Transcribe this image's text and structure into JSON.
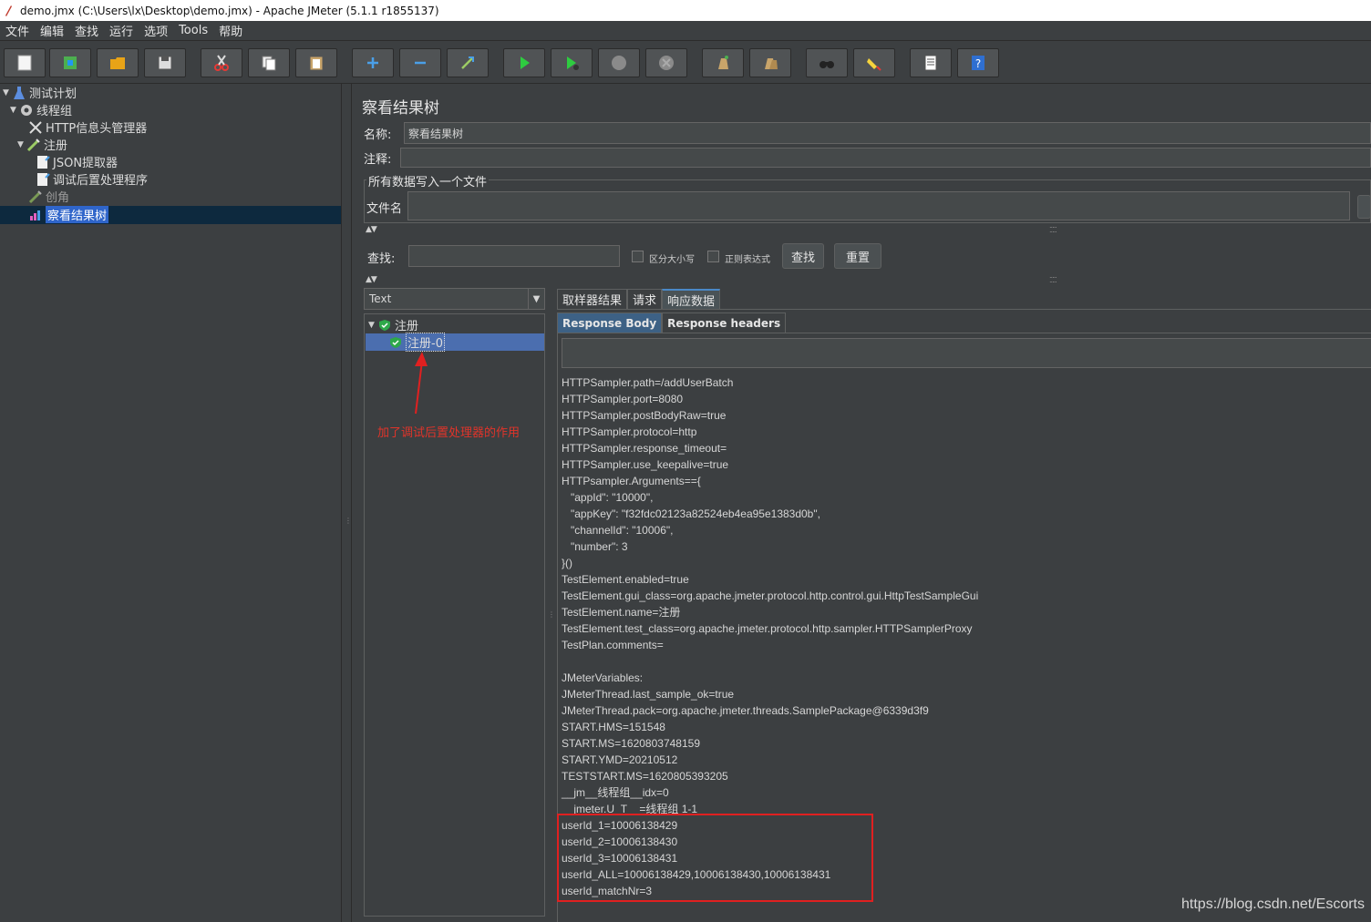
{
  "window": {
    "title": "demo.jmx (C:\\Users\\lx\\Desktop\\demo.jmx) - Apache JMeter (5.1.1 r1855137)"
  },
  "menubar": {
    "items": [
      {
        "label": "文件"
      },
      {
        "label": "编辑"
      },
      {
        "label": "查找"
      },
      {
        "label": "运行"
      },
      {
        "label": "选项"
      },
      {
        "label": "Tools"
      },
      {
        "label": "帮助"
      }
    ]
  },
  "toolbar": {
    "buttons": [
      {
        "icon": "new-icon"
      },
      {
        "icon": "templates-icon"
      },
      {
        "icon": "open-icon"
      },
      {
        "icon": "save-icon"
      },
      {
        "icon": "cut-icon"
      },
      {
        "icon": "copy-icon"
      },
      {
        "icon": "paste-icon"
      },
      {
        "icon": "expand-icon"
      },
      {
        "icon": "collapse-icon"
      },
      {
        "icon": "toggle-icon"
      },
      {
        "icon": "start-icon"
      },
      {
        "icon": "start-no-pause-icon"
      },
      {
        "icon": "stop-icon"
      },
      {
        "icon": "shutdown-icon"
      },
      {
        "icon": "clear-icon"
      },
      {
        "icon": "clear-all-icon"
      },
      {
        "icon": "search-icon"
      },
      {
        "icon": "reset-search-icon"
      },
      {
        "icon": "function-helper-icon"
      },
      {
        "icon": "help-icon"
      }
    ]
  },
  "tree": {
    "items": [
      {
        "label": "测试计划",
        "icon": "test-plan-icon"
      },
      {
        "label": "线程组",
        "icon": "thread-group-icon"
      },
      {
        "label": "HTTP信息头管理器",
        "icon": "header-manager-icon"
      },
      {
        "label": "注册",
        "icon": "sampler-icon"
      },
      {
        "label": "JSON提取器",
        "icon": "json-extractor-icon"
      },
      {
        "label": "调试后置处理程序",
        "icon": "debug-postprocessor-icon"
      },
      {
        "label": "创角",
        "icon": "sampler-icon"
      },
      {
        "label": "察看结果树",
        "icon": "results-tree-icon"
      }
    ]
  },
  "panel": {
    "title": "察看结果树",
    "name_label": "名称:",
    "name_value": "察看结果树",
    "comment_label": "注释:",
    "file_group_title": "所有数据写入一个文件",
    "filename_label": "文件名",
    "search_label": "查找:",
    "case_sensitive_label": "区分大小写",
    "regex_label": "正则表达式",
    "search_button": "查找",
    "reset_button": "重置",
    "renderer": "Text"
  },
  "results": {
    "parent": "注册",
    "child": "注册-0"
  },
  "tabs": {
    "main": [
      {
        "label": "取样器结果"
      },
      {
        "label": "请求"
      },
      {
        "label": "响应数据"
      }
    ],
    "sub": [
      {
        "label": "Response Body"
      },
      {
        "label": "Response headers"
      }
    ]
  },
  "response_lines": [
    "HTTPSampler.path=/addUserBatch",
    "HTTPSampler.port=8080",
    "HTTPSampler.postBodyRaw=true",
    "HTTPSampler.protocol=http",
    "HTTPSampler.response_timeout=",
    "HTTPSampler.use_keepalive=true",
    "HTTPsampler.Arguments=={",
    "   \"appId\": \"10000\",",
    "   \"appKey\": \"f32fdc02123a82524eb4ea95e1383d0b\",",
    "   \"channelId\": \"10006\",",
    "   \"number\": 3",
    "}()",
    "TestElement.enabled=true",
    "TestElement.gui_class=org.apache.jmeter.protocol.http.control.gui.HttpTestSampleGui",
    "TestElement.name=注册",
    "TestElement.test_class=org.apache.jmeter.protocol.http.sampler.HTTPSamplerProxy",
    "TestPlan.comments=",
    "",
    "JMeterVariables:",
    "JMeterThread.last_sample_ok=true",
    "JMeterThread.pack=org.apache.jmeter.threads.SamplePackage@6339d3f9",
    "START.HMS=151548",
    "START.MS=1620803748159",
    "START.YMD=20210512",
    "TESTSTART.MS=1620805393205",
    "__jm__线程组__idx=0",
    "__jmeter.U_T__=线程组 1-1",
    "userId_1=10006138429",
    "userId_2=10006138430",
    "userId_3=10006138431",
    "userId_ALL=10006138429,10006138430,10006138431",
    "userId_matchNr=3"
  ],
  "annotation": "加了调试后置处理器的作用",
  "watermark": "https://blog.csdn.net/Escorts",
  "colors": {
    "background": "#3c3f41",
    "selection": "#2f65ca",
    "annotation_red": "#e02020"
  }
}
